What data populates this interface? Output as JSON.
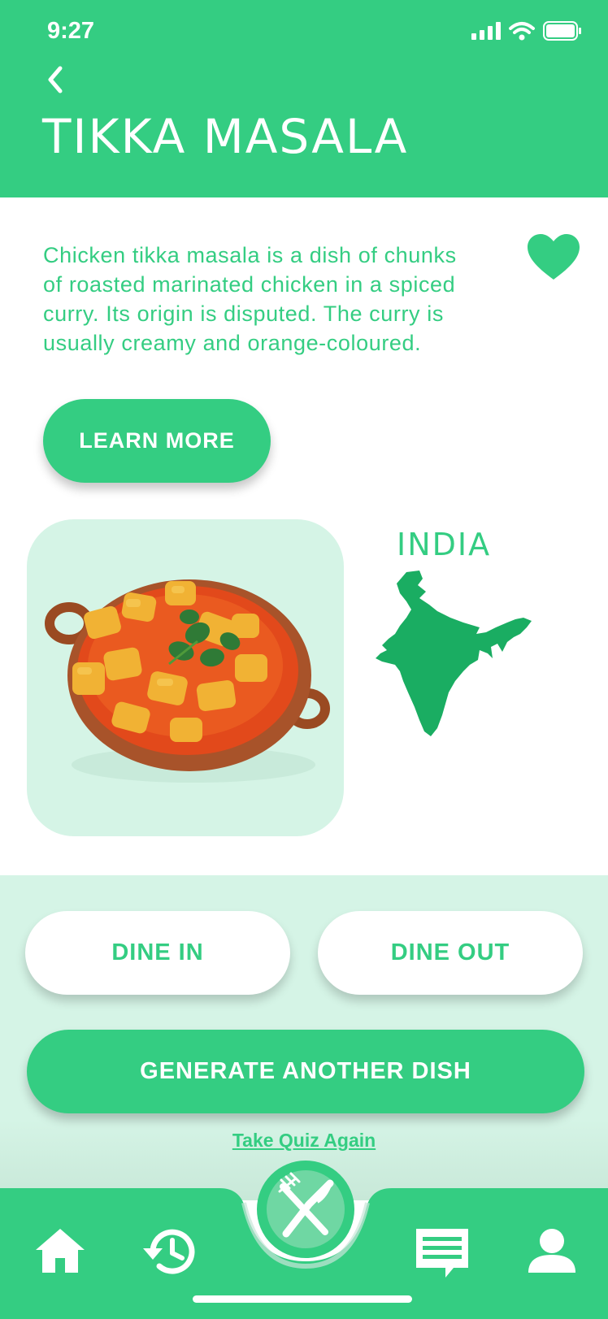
{
  "status_bar": {
    "time": "9:27",
    "icons": [
      "signal-icon",
      "wifi-icon",
      "battery-icon"
    ]
  },
  "header": {
    "title": "TIKKA MASALA",
    "back_icon": "chevron-left-icon"
  },
  "dish": {
    "description": "Chicken tikka masala is a dish of chunks of roasted marinated chicken in a spiced curry. Its origin is disputed. The curry is usually creamy and orange-coloured.",
    "favorite_icon": "heart-icon",
    "learn_more_label": "LEARN MORE",
    "image": "tikka-masala-dish-image",
    "country": "INDIA",
    "country_map": "india-map"
  },
  "actions": {
    "dine_in_label": "DINE IN",
    "dine_out_label": "DINE OUT",
    "generate_label": "GENERATE ANOTHER DISH",
    "quiz_link": "Take Quiz Again"
  },
  "bottom_nav": {
    "items": [
      "home-icon",
      "history-icon",
      "fork-knife-icon",
      "chat-icon",
      "profile-icon"
    ]
  },
  "colors": {
    "brand_green": "#34cd82",
    "mint": "#d5f4e6",
    "map_green": "#1aad62",
    "white": "#ffffff"
  }
}
